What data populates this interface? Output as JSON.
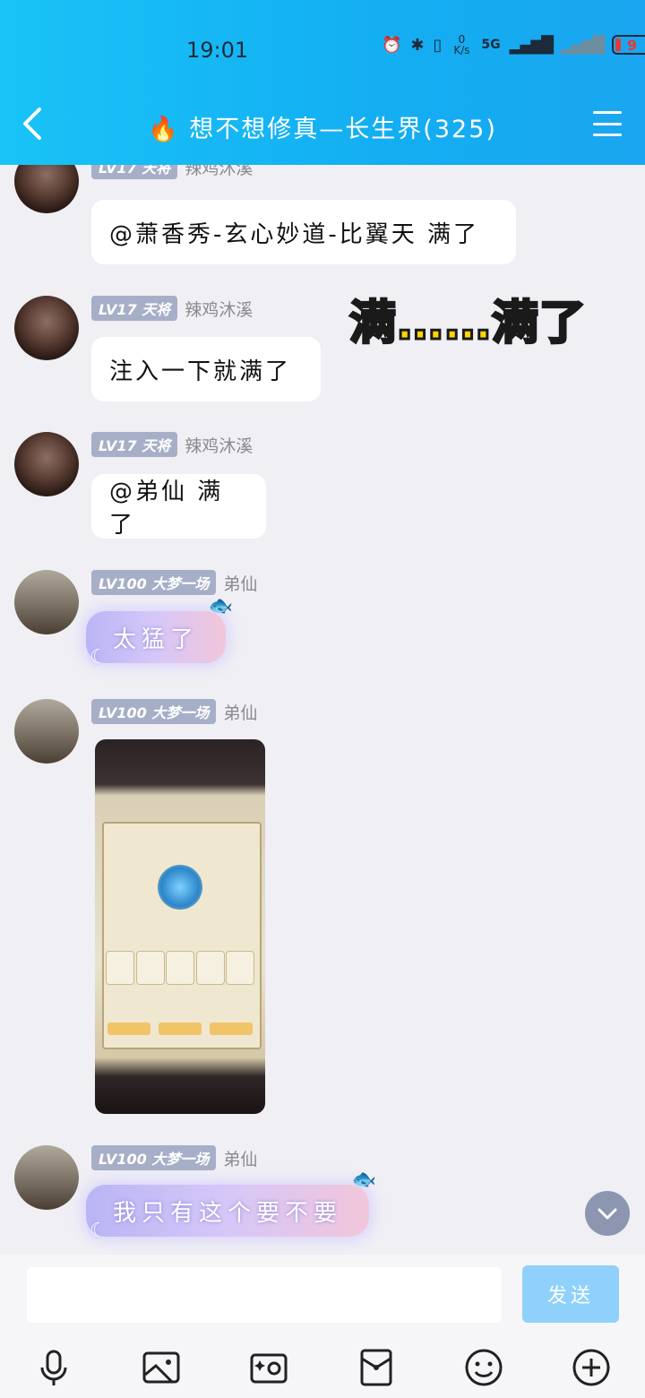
{
  "status_bar": {
    "time": "19:01",
    "net_speed": "0 K/s",
    "network": "5G",
    "battery": "9"
  },
  "header": {
    "title": "想不想修真—长生界(325)"
  },
  "messages": [
    {
      "level": "LV17 天将",
      "nickname": "辣鸡沐溪",
      "text": "@萧香秀-玄心妙道-比翼天 满了"
    },
    {
      "level": "LV17 天将",
      "nickname": "辣鸡沐溪",
      "text": "注入一下就满了",
      "sticker": "满……满了"
    },
    {
      "level": "LV17 天将",
      "nickname": "辣鸡沐溪",
      "text": "@弟仙 满了"
    },
    {
      "level": "LV100 大梦一场",
      "nickname": "弟仙",
      "text": "太猛了"
    },
    {
      "level": "LV100 大梦一场",
      "nickname": "弟仙",
      "image": "game-screenshot"
    },
    {
      "level": "LV100 大梦一场",
      "nickname": "弟仙",
      "text": "我只有这个要不要"
    }
  ],
  "input": {
    "placeholder": "",
    "send_label": "发送"
  },
  "toolbar": {
    "icons": [
      "microphone-icon",
      "image-icon",
      "camera-icon",
      "red-packet-icon",
      "emoji-icon",
      "plus-icon"
    ]
  }
}
